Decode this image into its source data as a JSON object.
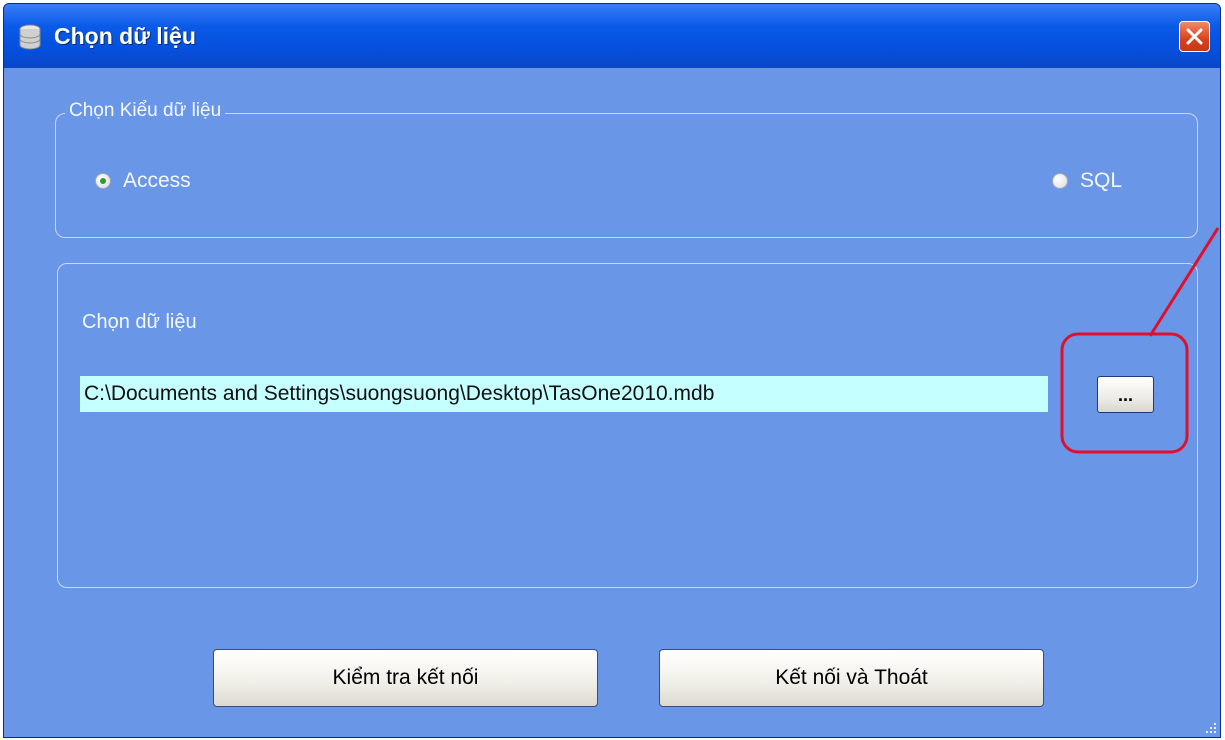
{
  "window": {
    "title": "Chọn dữ liệu",
    "title_icon": "database-icon",
    "close_icon": "close-icon"
  },
  "data_type_group": {
    "legend": "Chọn Kiểu dữ liệu",
    "options": [
      {
        "label": "Access",
        "selected": true
      },
      {
        "label": "SQL",
        "selected": false
      }
    ]
  },
  "data_select_group": {
    "label": "Chọn dữ liệu",
    "path_value": "C:\\Documents and Settings\\suongsuong\\Desktop\\TasOne2010.mdb",
    "browse_label": "..."
  },
  "buttons": {
    "test_connection": "Kiểm tra kết nối",
    "connect_exit": "Kết nối và Thoát"
  },
  "colors": {
    "annotation": "#e0102a",
    "path_background": "#c6ffff",
    "dialog_background": "#6a96e8"
  }
}
